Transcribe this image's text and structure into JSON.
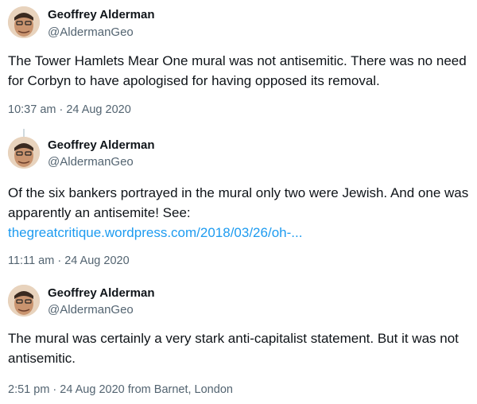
{
  "tweets": [
    {
      "author": "Geoffrey Alderman",
      "handle": "@AldermanGeo",
      "text": "The Tower Hamlets Mear One mural was not antisemitic. There was no need for Corbyn to have apologised for having opposed its removal.",
      "timestamp": "10:37 am · 24 Aug 2020"
    },
    {
      "author": "Geoffrey Alderman",
      "handle": "@AldermanGeo",
      "text": "Of the six bankers portrayed in the mural only two were Jewish. And one was apparently an antisemite! See:",
      "link": "thegreatcritique.wordpress.com/2018/03/26/oh-...",
      "timestamp": "11:11 am · 24 Aug 2020"
    },
    {
      "author": "Geoffrey Alderman",
      "handle": "@AldermanGeo",
      "text": "The mural was certainly a very stark anti-capitalist statement. But it was not antisemitic.",
      "timestamp": "2:51 pm · 24 Aug 2020 from Barnet, London"
    }
  ]
}
